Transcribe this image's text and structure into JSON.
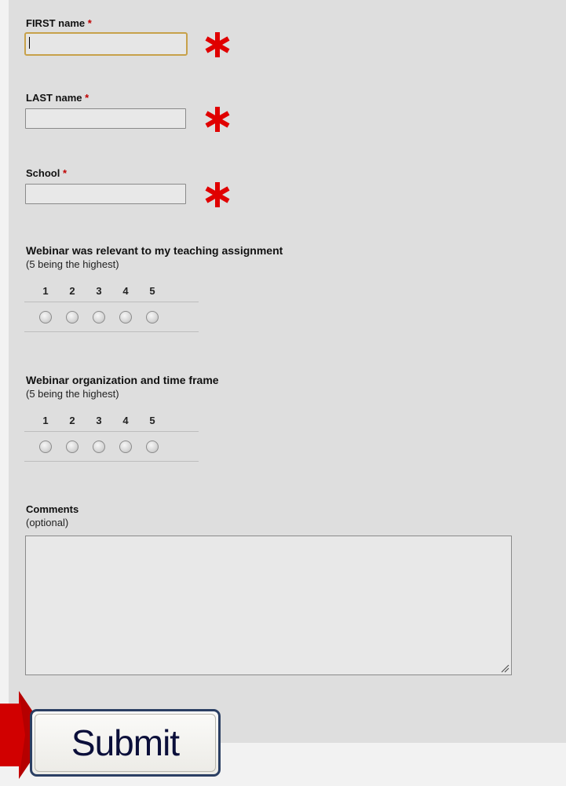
{
  "fields": {
    "first_name": {
      "label": "FIRST name",
      "required_mark": "*",
      "value": ""
    },
    "last_name": {
      "label": "LAST name",
      "required_mark": "*",
      "value": ""
    },
    "school": {
      "label": "School",
      "required_mark": "*",
      "value": ""
    }
  },
  "ratings": [
    {
      "question": "Webinar was relevant to my teaching assignment",
      "hint": "(5 being the highest)",
      "scale": [
        "1",
        "2",
        "3",
        "4",
        "5"
      ]
    },
    {
      "question": "Webinar organization and time frame",
      "hint": "(5 being the highest)",
      "scale": [
        "1",
        "2",
        "3",
        "4",
        "5"
      ]
    }
  ],
  "comments": {
    "label": "Comments",
    "hint": "(optional)",
    "value": ""
  },
  "submit": {
    "label": "Submit"
  },
  "colors": {
    "required_star": "#e00000",
    "arrow": "#d10000",
    "panel": "#dedede",
    "focus_border": "#c7a14a"
  },
  "icons": {
    "required_highlight": "red-asterisk-icon",
    "pointer": "red-arrow-icon",
    "resize": "resize-grip-icon"
  }
}
